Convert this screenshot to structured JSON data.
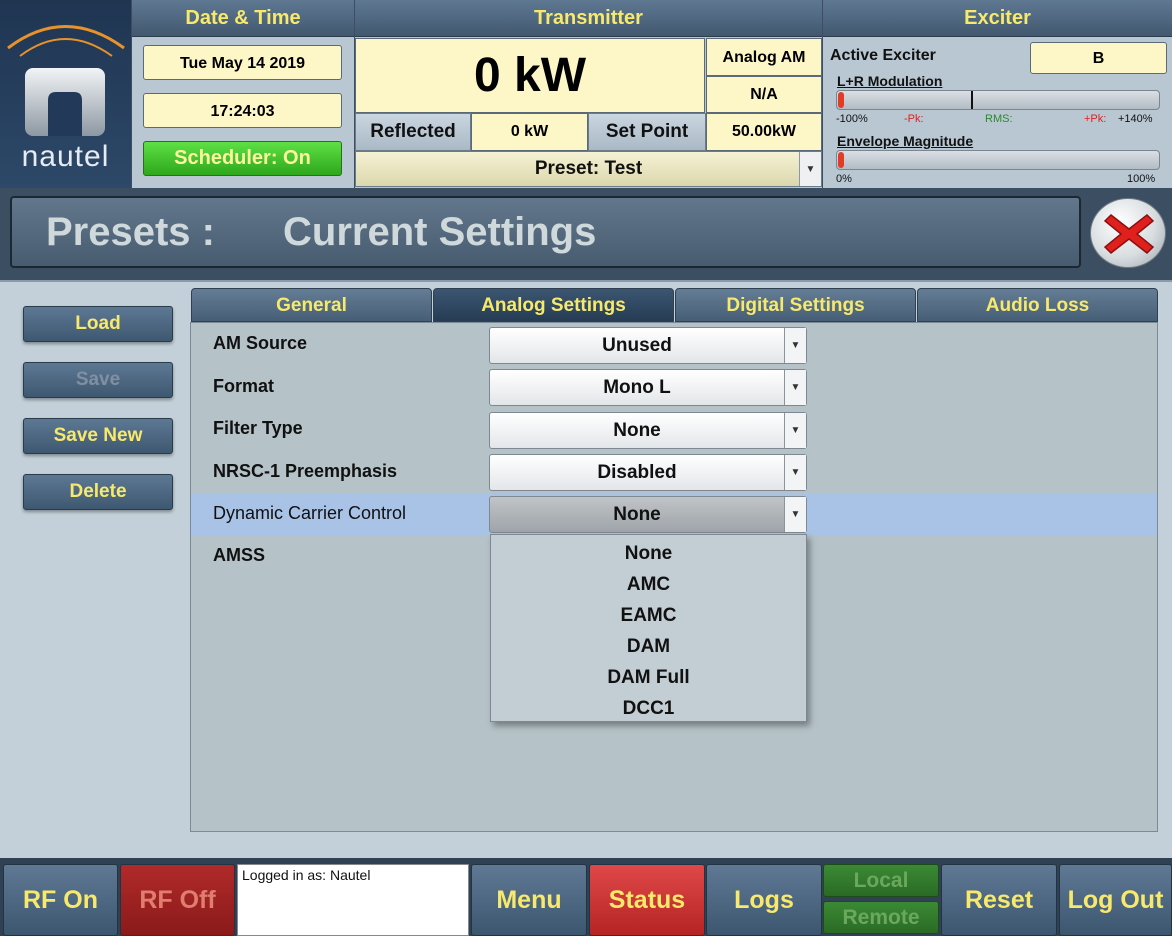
{
  "brand": {
    "logo_text": "nautel"
  },
  "datetime": {
    "title": "Date & Time",
    "date": "Tue May 14 2019",
    "time": "17:24:03",
    "scheduler": "Scheduler: On"
  },
  "transmitter": {
    "title": "Transmitter",
    "power": "0 kW",
    "mode": "Analog AM",
    "mode2": "N/A",
    "reflected_label": "Reflected",
    "reflected_value": "0 kW",
    "setpoint_label": "Set Point",
    "setpoint_value": "50.00kW",
    "preset": "Preset: Test"
  },
  "exciter": {
    "title": "Exciter",
    "active_label": "Active Exciter",
    "active_value": "B",
    "lr_label": "L+R Modulation",
    "lr_scale": {
      "min": "-100%",
      "pk_neg": "-Pk:",
      "rms": "RMS:",
      "pk_pos": "+Pk:",
      "max": "+140%"
    },
    "env_label": "Envelope Magnitude",
    "env_scale": {
      "min": "0%",
      "max": "100%"
    }
  },
  "page": {
    "title_prefix": "Presets :",
    "title": "Current Settings"
  },
  "sidebar": {
    "load": "Load",
    "save": "Save",
    "save_new": "Save New",
    "delete": "Delete"
  },
  "tabs": [
    "General",
    "Analog Settings",
    "Digital Settings",
    "Audio Loss"
  ],
  "fields": [
    {
      "label": "AM Source",
      "value": "Unused"
    },
    {
      "label": "Format",
      "value": "Mono L"
    },
    {
      "label": "Filter Type",
      "value": "None"
    },
    {
      "label": "NRSC-1 Preemphasis",
      "value": "Disabled"
    },
    {
      "label": "Dynamic Carrier Control",
      "value": "None"
    },
    {
      "label": "AMSS",
      "value": ""
    }
  ],
  "dropdown_options": [
    "None",
    "AMC",
    "EAMC",
    "DAM",
    "DAM Full",
    "DCC1"
  ],
  "footer": {
    "rf_on": "RF On",
    "rf_off": "RF Off",
    "logged_in": "Logged in as: Nautel",
    "menu": "Menu",
    "status": "Status",
    "logs": "Logs",
    "local": "Local",
    "remote": "Remote",
    "reset": "Reset",
    "logout": "Log Out"
  },
  "icons": {
    "close": "close-x-icon",
    "dropdown": "chevron-down-icon",
    "logo": "nautel-logo-icon"
  },
  "colors": {
    "accent_yellow": "#f7e96b",
    "scheduler_green": "#3cc42a",
    "status_red": "#d43a3a",
    "highlight_row": "#a9c3e6"
  }
}
